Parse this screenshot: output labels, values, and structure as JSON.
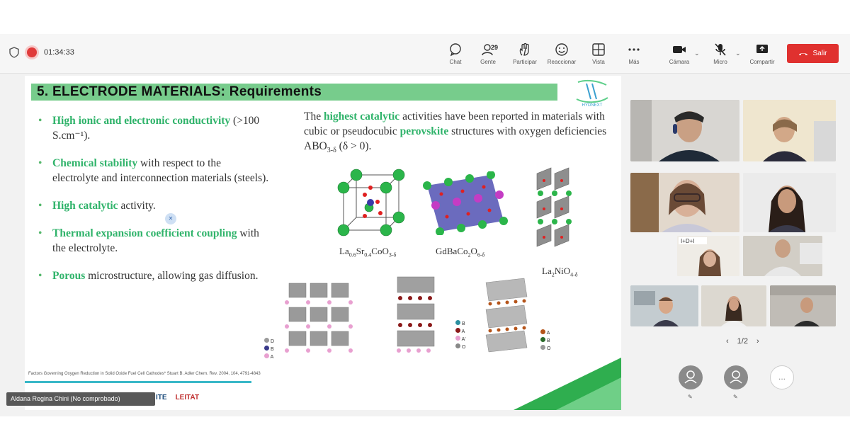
{
  "toolbar": {
    "timer": "01:34:33",
    "chat_label": "Chat",
    "people_label": "Gente",
    "people_count": "29",
    "participate_label": "Participar",
    "react_label": "Reaccionar",
    "view_label": "Vista",
    "more_label": "Más",
    "camera_label": "Cámara",
    "mic_label": "Micro",
    "share_label": "Compartir",
    "leave_label": "Salir",
    "leave_color": "#e0312f"
  },
  "slide": {
    "title": "5. ELECTRODE MATERIALS: Requirements",
    "banner_color": "#77cc8c",
    "accent_text_color": "#2fb36a",
    "bullets": [
      {
        "em": "High ionic and electronic conductivity",
        "rest": " (>100 S.cm⁻¹)."
      },
      {
        "em": "Chemical stability",
        "rest": " with respect to the electrolyte and interconnection materials (steels)."
      },
      {
        "em": "High catalytic",
        "rest": " activity."
      },
      {
        "em": "Thermal expansion coefficient coupling",
        "rest": " with the electrolyte."
      },
      {
        "em": "Porous",
        "rest": " microstructure, allowing gas diffusion."
      }
    ],
    "para_1": "The ",
    "para_em1": "highest catalytic",
    "para_2": " activities have been reported in materials with cubic or pseudocubic ",
    "para_em2": "perovskite",
    "para_3": " structures with oxygen deficiencies ABO",
    "para_sub": "3-δ",
    "para_4": " (δ > 0).",
    "crystals": [
      {
        "base": "La",
        "s1": "0.6",
        "m": "Sr",
        "s2": "0.4",
        "t": "CoO",
        "s3": "3-δ"
      },
      {
        "base": "GdBaCo",
        "s1": "2",
        "m": "O",
        "s2": "6-δ",
        "t": "",
        "s3": ""
      },
      {
        "base": "La",
        "s1": "2",
        "m": "NiO",
        "s2": "4-δ",
        "t": "",
        "s3": ""
      }
    ],
    "legend_a": [
      "D",
      "B",
      "A"
    ],
    "legend_b": [
      "B",
      "A",
      "A'",
      "O"
    ],
    "legend_c": [
      "A",
      "B",
      "O"
    ],
    "reference": "Factors Governing Oxygen Reduction in Solid Oxide Fuel Cell Cathodes* Stuart B. Adler Chem. Rev. 2004, 104, 4791-4843",
    "logo_text": "HYDNEXT"
  },
  "presenter_tag": "Aldana Regina Chini (No comprobado)",
  "sponsors": [
    "ITE",
    "LEITAT"
  ],
  "pager": {
    "text": "1/2",
    "prev": "‹",
    "next": "›"
  },
  "avatars_more": "..."
}
